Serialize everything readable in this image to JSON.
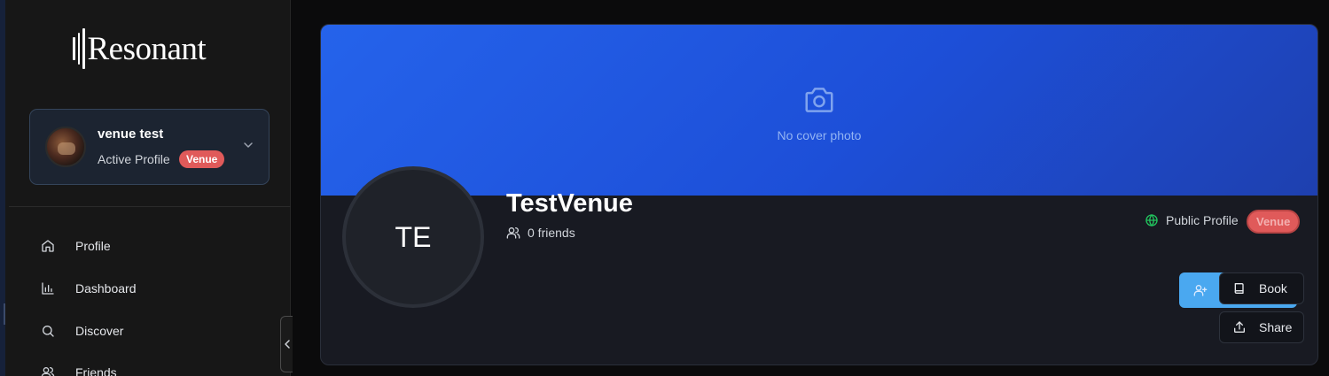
{
  "sidebar": {
    "logo_text": "Resonant",
    "profile": {
      "name": "venue test",
      "status": "Active Profile",
      "badge": "Venue"
    },
    "nav": [
      {
        "label": "Profile",
        "icon": "home-icon"
      },
      {
        "label": "Dashboard",
        "icon": "chart-icon"
      },
      {
        "label": "Discover",
        "icon": "search-icon"
      },
      {
        "label": "Friends",
        "icon": "users-icon"
      }
    ]
  },
  "main": {
    "cover_text": "No cover photo",
    "avatar_initials": "TE",
    "venue_name": "TestVenue",
    "friends_text": "0 friends",
    "visibility_text": "Public Profile",
    "badge": "Venue",
    "actions": {
      "book_label": "Book",
      "share_label": "Share"
    }
  },
  "colors": {
    "accent": "#2563eb",
    "badge": "#e05a5a",
    "add_button": "#4aa8f0",
    "public_icon": "#22c55e"
  }
}
